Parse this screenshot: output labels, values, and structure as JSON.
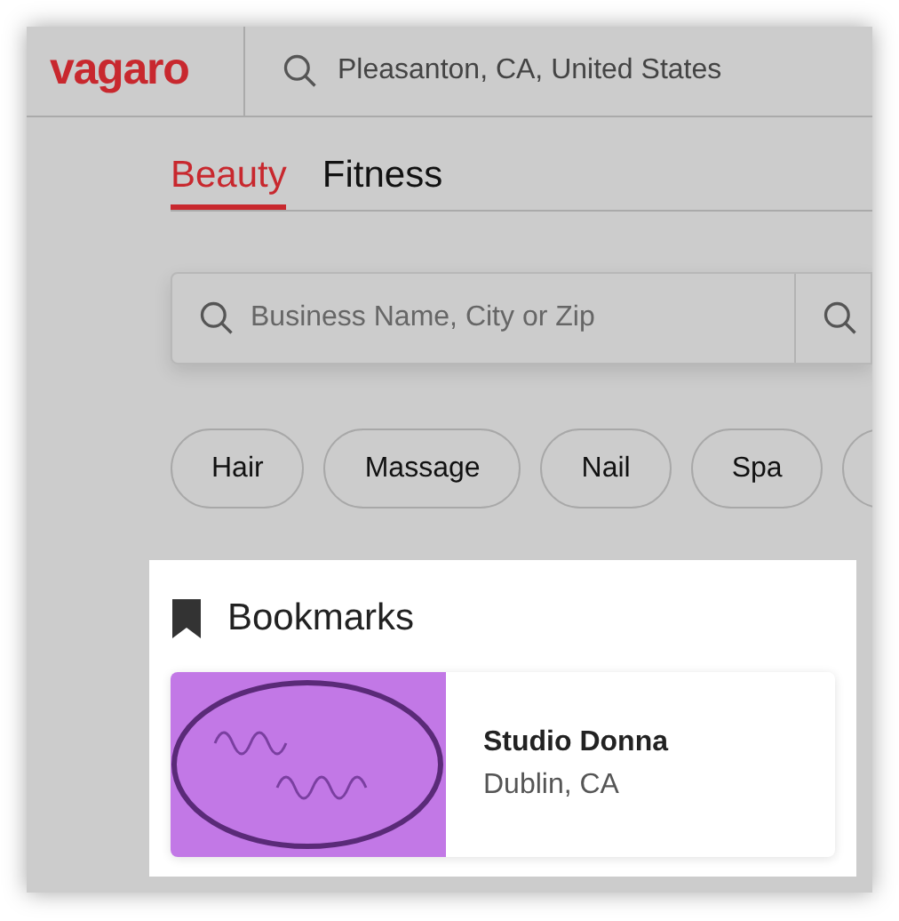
{
  "header": {
    "logo": "vagaro",
    "location": "Pleasanton, CA, United States"
  },
  "tabs": [
    {
      "label": "Beauty",
      "selected": true
    },
    {
      "label": "Fitness",
      "selected": false
    }
  ],
  "search": {
    "placeholder": "Business Name, City or Zip"
  },
  "categories": [
    "Hair",
    "Massage",
    "Nail",
    "Spa"
  ],
  "bookmarks": {
    "title": "Bookmarks",
    "items": [
      {
        "name": "Studio Donna",
        "location": "Dublin, CA"
      }
    ]
  }
}
